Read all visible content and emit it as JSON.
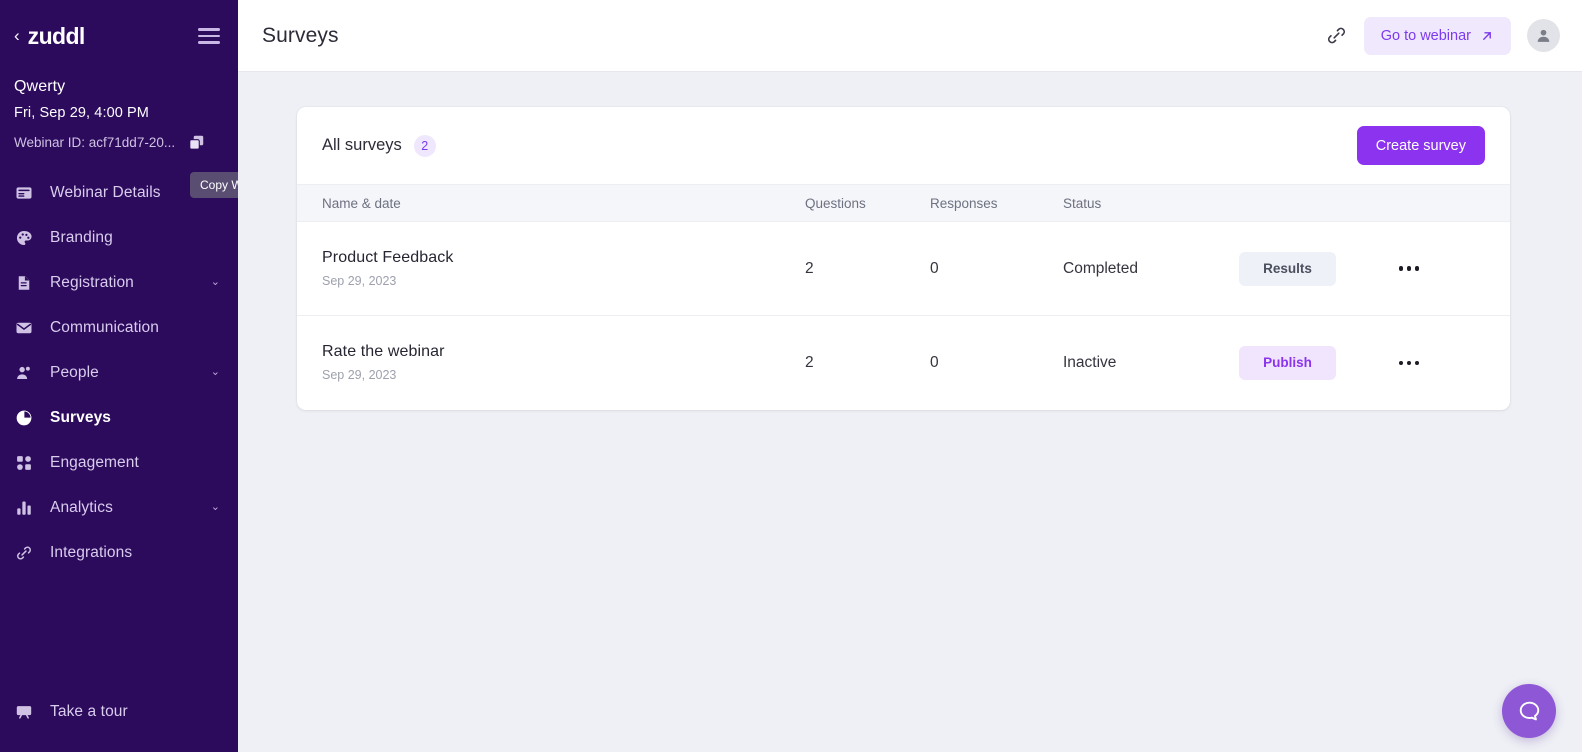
{
  "sidebar": {
    "logo_text": "zuddl",
    "back_icon": "chevron-left-icon",
    "menu_icon": "hamburger-menu-icon",
    "webinar_name": "Qwerty",
    "webinar_date": "Fri, Sep 29, 4:00 PM",
    "webinar_id_label": "Webinar ID: acf71dd7-20...",
    "copy_icon": "copy-icon",
    "tooltip": "Copy Webinar ID",
    "items": [
      {
        "label": "Webinar Details",
        "icon": "webinar-details-icon",
        "chevron": "",
        "active": false
      },
      {
        "label": "Branding",
        "icon": "palette-icon",
        "chevron": "",
        "active": false
      },
      {
        "label": "Registration",
        "icon": "document-icon",
        "chevron": "⌄",
        "active": false
      },
      {
        "label": "Communication",
        "icon": "envelope-icon",
        "chevron": "",
        "active": false
      },
      {
        "label": "People",
        "icon": "people-icon",
        "chevron": "⌄",
        "active": false
      },
      {
        "label": "Surveys",
        "icon": "pie-chart-icon",
        "chevron": "",
        "active": true
      },
      {
        "label": "Engagement",
        "icon": "grid-icon",
        "chevron": "",
        "active": false
      },
      {
        "label": "Analytics",
        "icon": "bar-chart-icon",
        "chevron": "⌄",
        "active": false
      },
      {
        "label": "Integrations",
        "icon": "link-chain-icon",
        "chevron": "",
        "active": false
      }
    ],
    "take_a_tour": {
      "label": "Take a tour",
      "icon": "presentation-icon"
    }
  },
  "topbar": {
    "title": "Surveys",
    "link_icon": "link-chain-icon",
    "go_to_webinar": "Go to webinar",
    "go_to_webinar_icon": "arrow-up-right-icon",
    "avatar_icon": "user-avatar-icon"
  },
  "surveys_card": {
    "title": "All surveys",
    "count": "2",
    "create_button": "Create survey",
    "columns": [
      "Name & date",
      "Questions",
      "Responses",
      "Status",
      "",
      ""
    ],
    "rows": [
      {
        "name": "Product Feedback",
        "date": "Sep 29, 2023",
        "questions": "2",
        "responses": "0",
        "status": "Completed",
        "action_label": "Results",
        "action_style": "results",
        "more_icon": "more-horizontal-icon"
      },
      {
        "name": "Rate the webinar",
        "date": "Sep 29, 2023",
        "questions": "2",
        "responses": "0",
        "status": "Inactive",
        "action_label": "Publish",
        "action_style": "publish",
        "more_icon": "more-horizontal-icon"
      }
    ]
  },
  "help_bubble": {
    "icon": "chat-bubble-icon"
  },
  "colors": {
    "sidebar_bg": "#2c0a5c",
    "accent_purple": "#8b33ee",
    "page_bg": "#eef0f5",
    "badge_bg": "#efe7fd"
  }
}
